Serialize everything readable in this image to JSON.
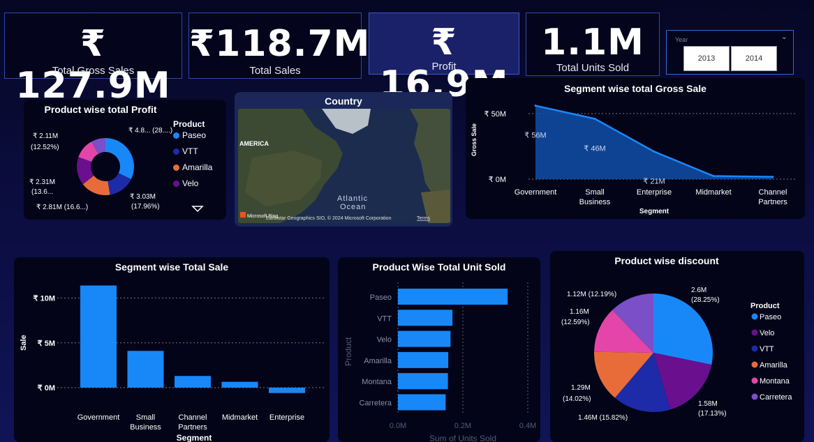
{
  "kpis": [
    {
      "value": "₹ 127.9M",
      "label": "Total Gross Sales"
    },
    {
      "value": "₹118.7M",
      "label": "Total Sales"
    },
    {
      "value": "₹ 16.9M",
      "label": "Profit"
    },
    {
      "value": "1.1M",
      "label": "Total Units Sold"
    }
  ],
  "slicer": {
    "label": "Year",
    "options": [
      "2013",
      "2014"
    ]
  },
  "product_profit": {
    "title": "Product wise total Profit",
    "legend_title": "Product",
    "legend": [
      "Paseo",
      "VTT",
      "Amarilla",
      "Velo"
    ],
    "labels": {
      "paseo": "₹ 4.8... (28....)",
      "vtt_v": "₹ 3.03M",
      "vtt_p": "(17.96%)",
      "amarilla": "₹ 2.81M (16.6...)",
      "velo_v": "₹ 2.31M",
      "velo_p": "(13.6...",
      "montana_v": "₹ 2.11M",
      "montana_p": "(12.52%)"
    }
  },
  "map": {
    "title": "Country",
    "continent": "AMERICA",
    "ocean_l1": "Atlantic",
    "ocean_l2": "Ocean",
    "brand": "Microsoft Bing",
    "credit": "Earthstar Geographics SIO, © 2024 Microsoft Corporation",
    "terms": "Terms"
  },
  "chart_data": [
    {
      "type": "area",
      "title": "Segment wise total Gross Sale",
      "xlabel": "Segment",
      "ylabel": "Gross Sale",
      "categories": [
        "Government",
        "Small Business",
        "Enterprise",
        "Midmarket",
        "Channel Partners"
      ],
      "values": [
        56,
        46,
        21,
        2.4,
        1.8
      ],
      "value_labels": [
        "₹ 56M",
        "₹ 46M",
        "₹ 21M",
        "",
        ""
      ],
      "yticks": [
        "₹ 50M",
        "₹ 0M"
      ],
      "ylim": [
        0,
        60
      ],
      "color": "#1888f8"
    },
    {
      "type": "bar",
      "title": "Segment wise Total Sale",
      "xlabel": "Segment",
      "ylabel": "Sale",
      "categories": [
        "Government",
        "Small Business",
        "Channel Partners",
        "Midmarket",
        "Enterprise"
      ],
      "values": [
        11.4,
        4.1,
        1.3,
        0.65,
        -0.6
      ],
      "yticks": [
        "₹ 10M",
        "₹ 5M",
        "₹ 0M"
      ],
      "ylim": [
        -1,
        12
      ],
      "color": "#1888f8"
    },
    {
      "type": "bar",
      "orientation": "horizontal",
      "title": "Product Wise Total Unit Sold",
      "xlabel": "Sum of Units Sold",
      "ylabel": "Product",
      "categories": [
        "Paseo",
        "VTT",
        "Velo",
        "Amarilla",
        "Montana",
        "Carretera"
      ],
      "values": [
        0.338,
        0.168,
        0.162,
        0.155,
        0.154,
        0.147
      ],
      "xticks": [
        "0.0M",
        "0.2M",
        "0.4M"
      ],
      "xlim": [
        0,
        0.4
      ],
      "color": "#1888f8"
    },
    {
      "type": "pie",
      "title": "Product wise discount",
      "legend_title": "Product",
      "categories": [
        "Paseo",
        "Velo",
        "VTT",
        "Amarilla",
        "Montana",
        "Carretera"
      ],
      "values": [
        2.6,
        1.58,
        1.46,
        1.29,
        1.16,
        1.12
      ],
      "percent": [
        "28.25%",
        "17.13%",
        "15.82%",
        "14.02%",
        "12.59%",
        "12.19%"
      ],
      "labels": [
        "2.6M",
        "(28.25%)",
        "1.58M",
        "(17.13%)",
        "1.46M (15.82%)",
        "1.29M",
        "(14.02%)",
        "1.16M",
        "(12.59%)",
        "1.12M (12.19%)"
      ],
      "colors": [
        "#1888f8",
        "#6a0f8e",
        "#1d2ba8",
        "#e86c3a",
        "#e346a8",
        "#7b4fc8"
      ]
    }
  ]
}
